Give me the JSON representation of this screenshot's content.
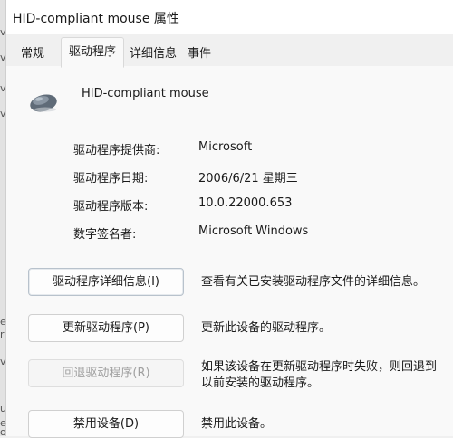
{
  "window": {
    "title": "HID-compliant mouse 属性"
  },
  "tabs": [
    {
      "label": "常规"
    },
    {
      "label": "驱动程序"
    },
    {
      "label": "详细信息"
    },
    {
      "label": "事件"
    }
  ],
  "device": {
    "name": "HID-compliant mouse",
    "icon": "mouse-icon"
  },
  "info": [
    {
      "label": "驱动程序提供商:",
      "value": "Microsoft"
    },
    {
      "label": "驱动程序日期:",
      "value": "2006/6/21 星期三"
    },
    {
      "label": "驱动程序版本:",
      "value": "10.0.22000.653"
    },
    {
      "label": "数字签名者:",
      "value": "Microsoft Windows"
    }
  ],
  "actions": [
    {
      "button": "驱动程序详细信息(I)",
      "description": [
        "查看有关已安装驱动程序文件的详细信息。"
      ]
    },
    {
      "button": "更新驱动程序(P)",
      "description": [
        "更新此设备的驱动程序。"
      ]
    },
    {
      "button": "回退驱动程序(R)",
      "disabled": true,
      "description": [
        "如果该设备在更新驱动程序时失败，则回退到",
        "以前安装的驱动程序。"
      ]
    },
    {
      "button": "禁用设备(D)",
      "description": [
        "禁用此设备。"
      ]
    }
  ],
  "background_window_edge": [
    "v",
    "v",
    "v",
    "v",
    "e",
    "r",
    "v",
    "u",
    "e",
    "o"
  ],
  "colors": {
    "panel": "#f9f9f9",
    "tab_strip": "#f0f0f0",
    "titlebar": "#ffffff",
    "disabled_text": "#a0a0a0"
  }
}
